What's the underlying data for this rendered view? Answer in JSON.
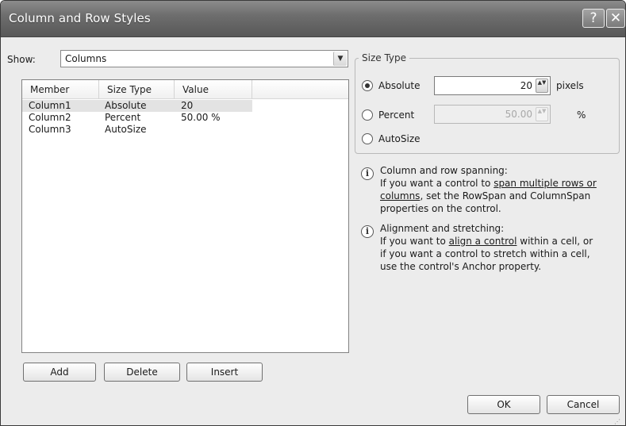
{
  "window": {
    "title": "Column and Row Styles",
    "help_glyph": "?",
    "close_glyph": "✕"
  },
  "show": {
    "label": "Show:",
    "value": "Columns",
    "arrow": "▼"
  },
  "list": {
    "columns": [
      "Member",
      "Size Type",
      "Value"
    ],
    "rows": [
      {
        "member": "Column1",
        "size_type": "Absolute",
        "value": "20",
        "selected": true
      },
      {
        "member": "Column2",
        "size_type": "Percent",
        "value": "50.00 %",
        "selected": false
      },
      {
        "member": "Column3",
        "size_type": "AutoSize",
        "value": "",
        "selected": false
      }
    ]
  },
  "buttons": {
    "add": "Add",
    "delete": "Delete",
    "insert": "Insert",
    "ok": "OK",
    "cancel": "Cancel"
  },
  "size_type": {
    "legend": "Size Type",
    "absolute": {
      "label": "Absolute",
      "value": "20",
      "unit": "pixels",
      "selected": true
    },
    "percent": {
      "label": "Percent",
      "value": "50.00",
      "unit": "%",
      "selected": false
    },
    "autosize": {
      "label": "AutoSize",
      "selected": false
    },
    "spinner_glyph": "▲▼"
  },
  "info": {
    "icon_glyph": "i",
    "spanning": {
      "heading": "Column and row spanning:",
      "pre": "If you want a control to ",
      "link1": "span multiple rows or",
      "link2": "columns",
      "post": ", set the RowSpan and ColumnSpan",
      "line4": "properties on the control."
    },
    "alignment": {
      "heading": "Alignment and stretching:",
      "pre": "If you want to ",
      "link": "align a control",
      "post": " within a cell, or",
      "line3": "if you want a control to stretch within a cell,",
      "line4": "use the control's Anchor property."
    }
  },
  "grip_glyph": "⋰"
}
